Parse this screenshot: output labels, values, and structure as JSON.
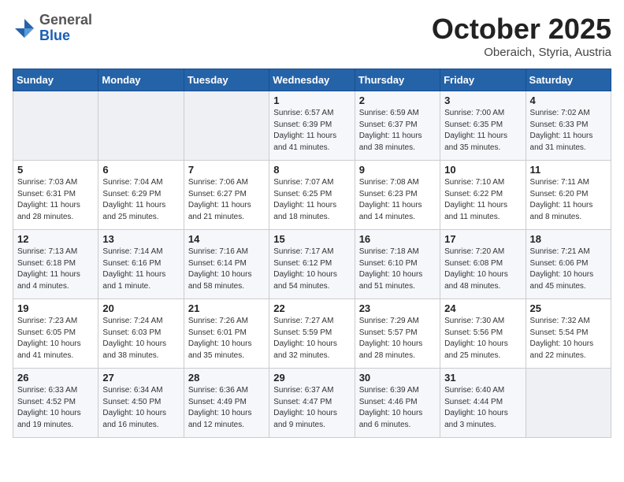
{
  "header": {
    "logo_general": "General",
    "logo_blue": "Blue",
    "title": "October 2025",
    "subtitle": "Oberaich, Styria, Austria"
  },
  "days_of_week": [
    "Sunday",
    "Monday",
    "Tuesday",
    "Wednesday",
    "Thursday",
    "Friday",
    "Saturday"
  ],
  "weeks": [
    [
      {
        "day": "",
        "info": ""
      },
      {
        "day": "",
        "info": ""
      },
      {
        "day": "",
        "info": ""
      },
      {
        "day": "1",
        "info": "Sunrise: 6:57 AM\nSunset: 6:39 PM\nDaylight: 11 hours\nand 41 minutes."
      },
      {
        "day": "2",
        "info": "Sunrise: 6:59 AM\nSunset: 6:37 PM\nDaylight: 11 hours\nand 38 minutes."
      },
      {
        "day": "3",
        "info": "Sunrise: 7:00 AM\nSunset: 6:35 PM\nDaylight: 11 hours\nand 35 minutes."
      },
      {
        "day": "4",
        "info": "Sunrise: 7:02 AM\nSunset: 6:33 PM\nDaylight: 11 hours\nand 31 minutes."
      }
    ],
    [
      {
        "day": "5",
        "info": "Sunrise: 7:03 AM\nSunset: 6:31 PM\nDaylight: 11 hours\nand 28 minutes."
      },
      {
        "day": "6",
        "info": "Sunrise: 7:04 AM\nSunset: 6:29 PM\nDaylight: 11 hours\nand 25 minutes."
      },
      {
        "day": "7",
        "info": "Sunrise: 7:06 AM\nSunset: 6:27 PM\nDaylight: 11 hours\nand 21 minutes."
      },
      {
        "day": "8",
        "info": "Sunrise: 7:07 AM\nSunset: 6:25 PM\nDaylight: 11 hours\nand 18 minutes."
      },
      {
        "day": "9",
        "info": "Sunrise: 7:08 AM\nSunset: 6:23 PM\nDaylight: 11 hours\nand 14 minutes."
      },
      {
        "day": "10",
        "info": "Sunrise: 7:10 AM\nSunset: 6:22 PM\nDaylight: 11 hours\nand 11 minutes."
      },
      {
        "day": "11",
        "info": "Sunrise: 7:11 AM\nSunset: 6:20 PM\nDaylight: 11 hours\nand 8 minutes."
      }
    ],
    [
      {
        "day": "12",
        "info": "Sunrise: 7:13 AM\nSunset: 6:18 PM\nDaylight: 11 hours\nand 4 minutes."
      },
      {
        "day": "13",
        "info": "Sunrise: 7:14 AM\nSunset: 6:16 PM\nDaylight: 11 hours\nand 1 minute."
      },
      {
        "day": "14",
        "info": "Sunrise: 7:16 AM\nSunset: 6:14 PM\nDaylight: 10 hours\nand 58 minutes."
      },
      {
        "day": "15",
        "info": "Sunrise: 7:17 AM\nSunset: 6:12 PM\nDaylight: 10 hours\nand 54 minutes."
      },
      {
        "day": "16",
        "info": "Sunrise: 7:18 AM\nSunset: 6:10 PM\nDaylight: 10 hours\nand 51 minutes."
      },
      {
        "day": "17",
        "info": "Sunrise: 7:20 AM\nSunset: 6:08 PM\nDaylight: 10 hours\nand 48 minutes."
      },
      {
        "day": "18",
        "info": "Sunrise: 7:21 AM\nSunset: 6:06 PM\nDaylight: 10 hours\nand 45 minutes."
      }
    ],
    [
      {
        "day": "19",
        "info": "Sunrise: 7:23 AM\nSunset: 6:05 PM\nDaylight: 10 hours\nand 41 minutes."
      },
      {
        "day": "20",
        "info": "Sunrise: 7:24 AM\nSunset: 6:03 PM\nDaylight: 10 hours\nand 38 minutes."
      },
      {
        "day": "21",
        "info": "Sunrise: 7:26 AM\nSunset: 6:01 PM\nDaylight: 10 hours\nand 35 minutes."
      },
      {
        "day": "22",
        "info": "Sunrise: 7:27 AM\nSunset: 5:59 PM\nDaylight: 10 hours\nand 32 minutes."
      },
      {
        "day": "23",
        "info": "Sunrise: 7:29 AM\nSunset: 5:57 PM\nDaylight: 10 hours\nand 28 minutes."
      },
      {
        "day": "24",
        "info": "Sunrise: 7:30 AM\nSunset: 5:56 PM\nDaylight: 10 hours\nand 25 minutes."
      },
      {
        "day": "25",
        "info": "Sunrise: 7:32 AM\nSunset: 5:54 PM\nDaylight: 10 hours\nand 22 minutes."
      }
    ],
    [
      {
        "day": "26",
        "info": "Sunrise: 6:33 AM\nSunset: 4:52 PM\nDaylight: 10 hours\nand 19 minutes."
      },
      {
        "day": "27",
        "info": "Sunrise: 6:34 AM\nSunset: 4:50 PM\nDaylight: 10 hours\nand 16 minutes."
      },
      {
        "day": "28",
        "info": "Sunrise: 6:36 AM\nSunset: 4:49 PM\nDaylight: 10 hours\nand 12 minutes."
      },
      {
        "day": "29",
        "info": "Sunrise: 6:37 AM\nSunset: 4:47 PM\nDaylight: 10 hours\nand 9 minutes."
      },
      {
        "day": "30",
        "info": "Sunrise: 6:39 AM\nSunset: 4:46 PM\nDaylight: 10 hours\nand 6 minutes."
      },
      {
        "day": "31",
        "info": "Sunrise: 6:40 AM\nSunset: 4:44 PM\nDaylight: 10 hours\nand 3 minutes."
      },
      {
        "day": "",
        "info": ""
      }
    ]
  ]
}
